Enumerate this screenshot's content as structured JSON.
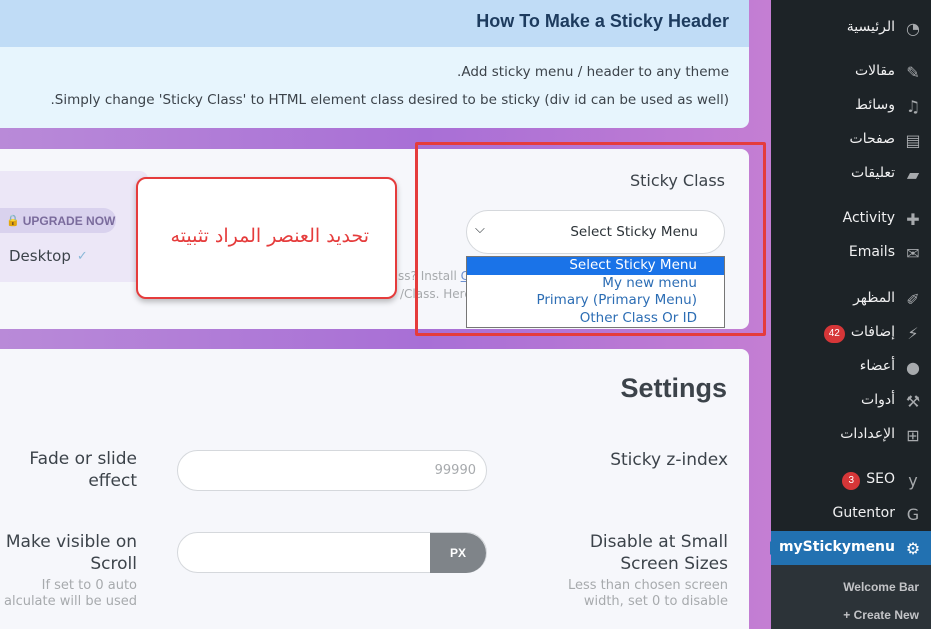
{
  "how_to": {
    "title": "How To Make a Sticky Header",
    "line1": ".Add sticky menu / header to any theme",
    "line2": ".Simply change 'Sticky Class' to HTML element class desired to be sticky (div id can be used as well)"
  },
  "upgrade": {
    "label": "UPGRADE NOW",
    "icon": "lock-icon"
  },
  "device": {
    "label": "Desktop",
    "checked": true
  },
  "sticky_class": {
    "label": "Sticky Class",
    "selected": "Select Sticky Menu",
    "options": [
      "Select Sticky Menu",
      "My new menu",
      "Primary (Primary Menu)",
      "Other Class Or ID"
    ],
    "help_fragment1": "ss? Install",
    "help_link": "C",
    "help_fragment2": "/Class. Here"
  },
  "callout": {
    "text": "تحديد العنصر المراد تثبيته"
  },
  "settings": {
    "title": "Settings",
    "z_index_label": "Sticky z-index",
    "z_index_placeholder": "99990",
    "fade_label_line1": "Fade or slide",
    "fade_label_line2": "effect",
    "disable_small_line1": "Disable at Small",
    "disable_small_line2": "Screen Sizes",
    "disable_help_line1": "Less than chosen screen",
    "disable_help_line2": "width, set 0 to disable",
    "visible_scroll_line1": "Make visible on",
    "visible_scroll_line2": "Scroll",
    "visible_help_line1": "If set to 0 auto",
    "visible_help_line2": "alculate will be used",
    "px_unit": "PX"
  },
  "sidebar": {
    "items": [
      {
        "label": "الرئيسية",
        "icon": "dashboard-icon"
      },
      {
        "label": "مقالات",
        "icon": "pin-icon"
      },
      {
        "label": "وسائط",
        "icon": "media-icon"
      },
      {
        "label": "صفحات",
        "icon": "pages-icon"
      },
      {
        "label": "تعليقات",
        "icon": "comments-icon"
      },
      {
        "label": "Activity",
        "icon": "activity-icon"
      },
      {
        "label": "Emails",
        "icon": "email-icon"
      },
      {
        "label": "المظهر",
        "icon": "appearance-icon"
      },
      {
        "label": "إضافات",
        "icon": "plugins-icon",
        "badge": "42"
      },
      {
        "label": "أعضاء",
        "icon": "users-icon"
      },
      {
        "label": "أدوات",
        "icon": "tools-icon"
      },
      {
        "label": "الإعدادات",
        "icon": "settings-icon"
      },
      {
        "label": "SEO",
        "icon": "yoast-icon",
        "badge": "3"
      },
      {
        "label": "Gutentor",
        "icon": "gutentor-icon"
      },
      {
        "label": "myStickymenu",
        "icon": "gear-icon",
        "current": true
      }
    ],
    "submenu": [
      "Welcome Bar",
      "Create New +"
    ]
  },
  "colors": {
    "accent": "#2271b1",
    "highlight": "#e53c3c",
    "sidebar_bg": "#1d2327",
    "badge": "#d63638"
  }
}
